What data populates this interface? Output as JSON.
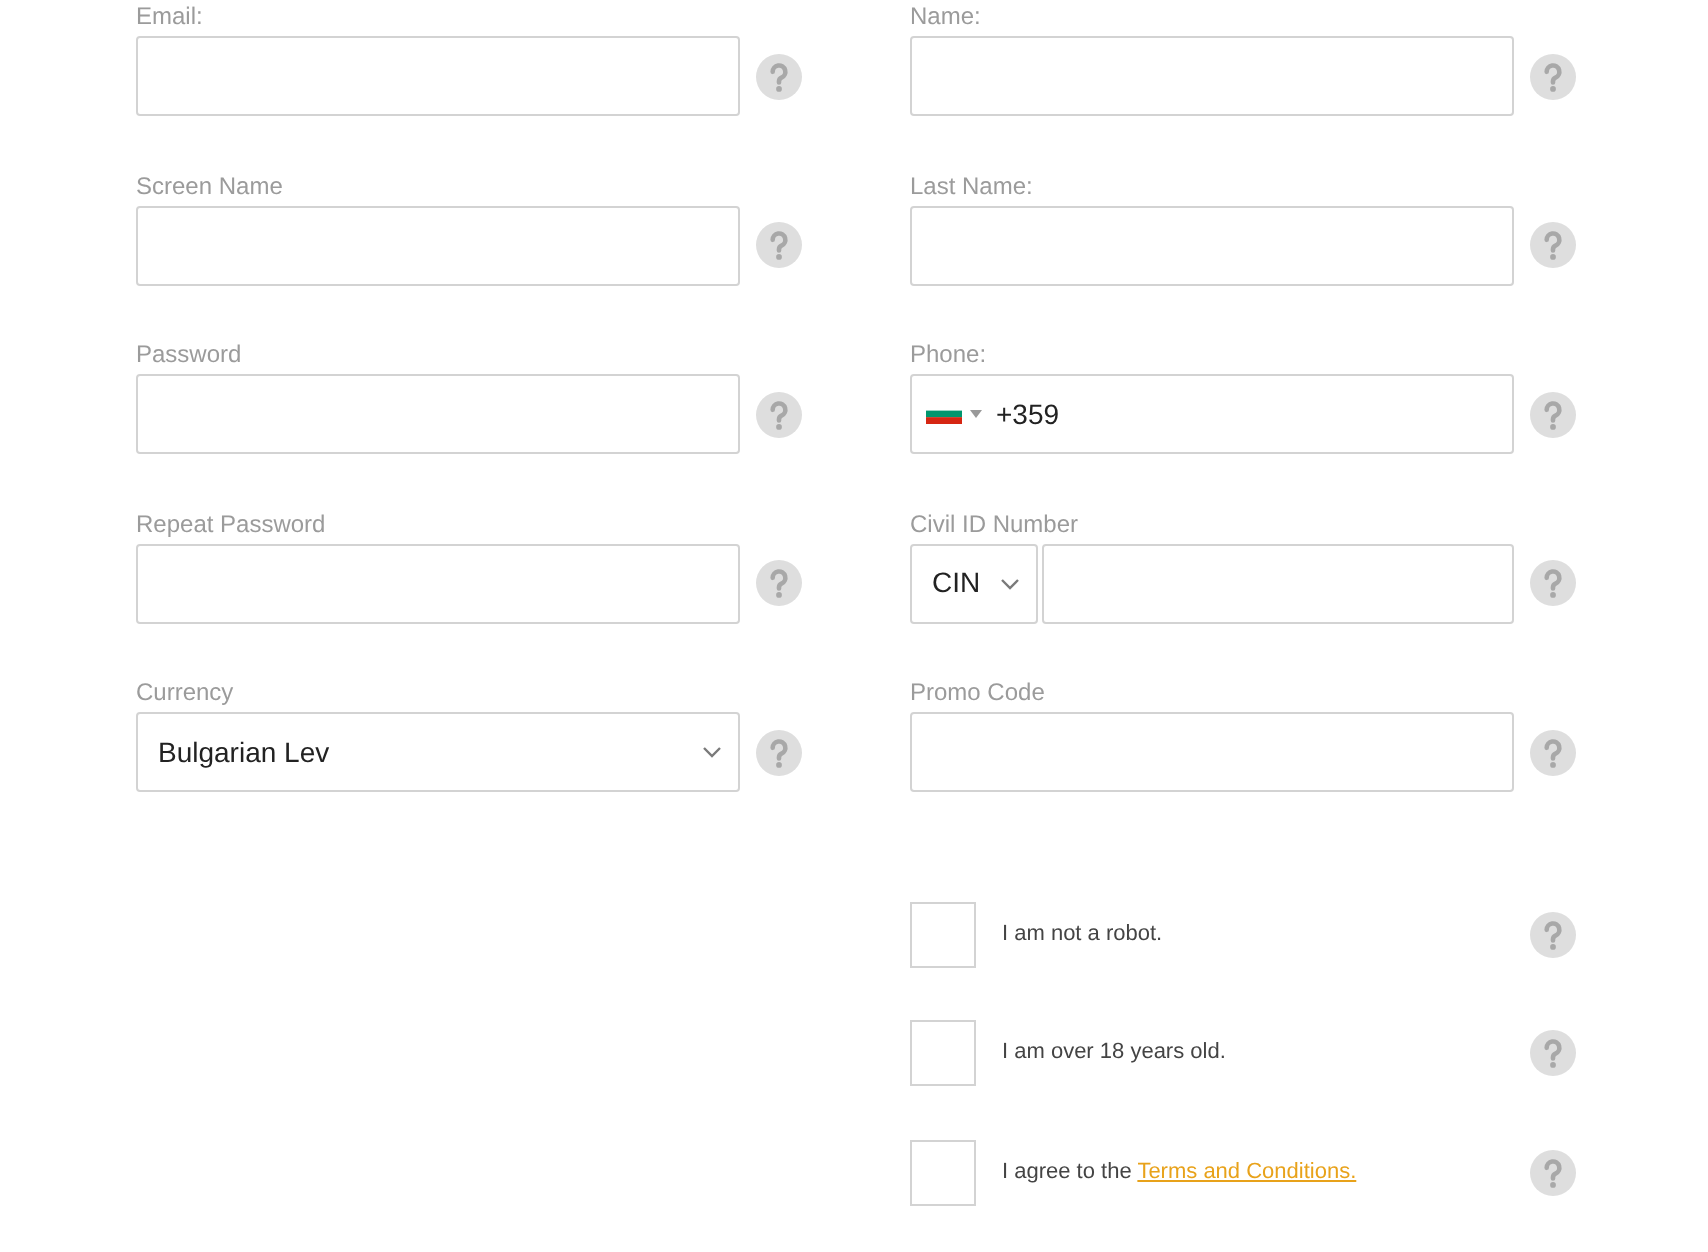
{
  "left_fields": [
    {
      "label": "Email:",
      "kind": "text"
    },
    {
      "label": "Screen Name",
      "kind": "text"
    },
    {
      "label": "Password",
      "kind": "text"
    },
    {
      "label": "Repeat Password",
      "kind": "text"
    },
    {
      "label": "Currency",
      "kind": "select",
      "value": "Bulgarian Lev"
    }
  ],
  "right_fields": [
    {
      "label": "Name:",
      "kind": "text"
    },
    {
      "label": "Last Name:",
      "kind": "text"
    },
    {
      "label": "Phone:",
      "kind": "phone",
      "value": "+359"
    },
    {
      "label": "Civil ID Number",
      "kind": "id",
      "id_type": "CIN"
    },
    {
      "label": "Promo Code",
      "kind": "text"
    }
  ],
  "agreements": [
    {
      "text": "I am not a robot.",
      "checked": false
    },
    {
      "text": "I am over 18 years old.",
      "checked": false
    },
    {
      "text": "I agree to the",
      "link": "Terms and Conditions.",
      "checked": false
    }
  ]
}
